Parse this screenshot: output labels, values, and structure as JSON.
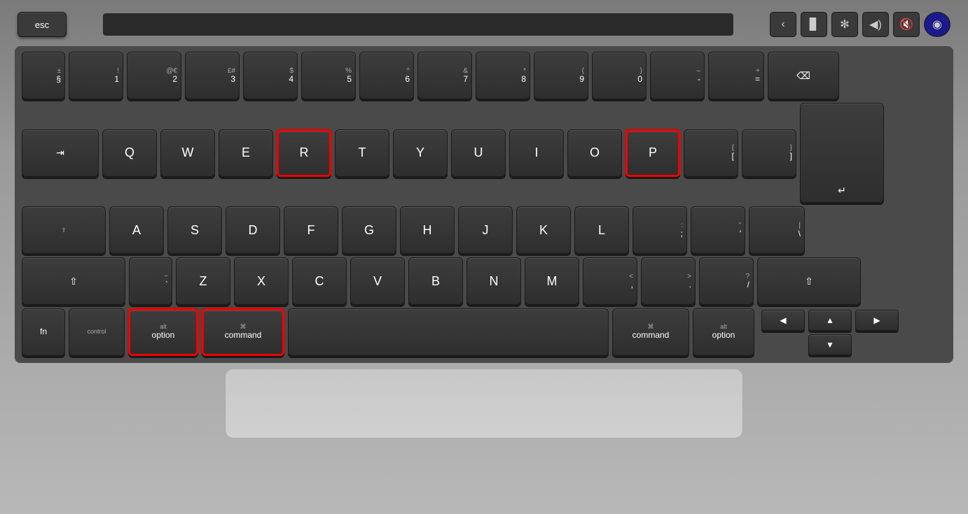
{
  "keyboard": {
    "touchbar": {
      "esc_label": "esc",
      "icons": [
        "‹",
        "▌▌",
        "✦",
        "🔊",
        "🔇",
        "⏺"
      ]
    },
    "rows": {
      "number_row": [
        "§\n±",
        "1\n!",
        "2\n@€",
        "3\n£#",
        "4\n$",
        "5\n%",
        "6\n^",
        "7\n&",
        "8\n*",
        "9\n(",
        "0\n)",
        "-\n–",
        "=\n+"
      ],
      "qwerty_row": [
        "Q",
        "W",
        "E",
        "R",
        "T",
        "Y",
        "U",
        "I",
        "O",
        "P"
      ],
      "asdf_row": [
        "A",
        "S",
        "D",
        "F",
        "G",
        "H",
        "J",
        "K",
        "L"
      ],
      "zxcv_row": [
        "Z",
        "X",
        "C",
        "V",
        "B",
        "N",
        "M"
      ]
    },
    "highlighted_keys": [
      "R",
      "P",
      "option_left",
      "command_left"
    ],
    "colors": {
      "key_bg": "#333333",
      "key_highlight": "#cc0000",
      "keyboard_body": "#4a4a4a"
    }
  }
}
